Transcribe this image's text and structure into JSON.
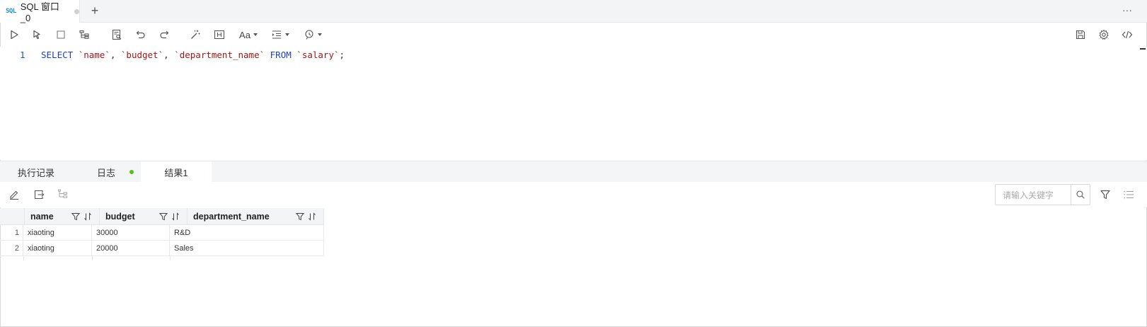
{
  "tab": {
    "icon": "sql-icon",
    "icon_text": "SQL",
    "title": "SQL 窗口_0",
    "add": "+",
    "more": "···"
  },
  "editor": {
    "line_number": "1",
    "tokens": {
      "select": "SELECT",
      "name": "`name`",
      "c1": ", ",
      "budget": "`budget`",
      "c2": ", ",
      "dept": "`department_name`",
      "from": "FROM",
      "table": "`salary`",
      "semi": ";"
    }
  },
  "result_tabs": [
    "执行记录",
    "日志",
    "结果1"
  ],
  "result_active": "结果1",
  "search": {
    "placeholder": "请输入关键字"
  },
  "table": {
    "columns": [
      "name",
      "budget",
      "department_name"
    ],
    "rows": [
      {
        "n": "1",
        "name": "xiaoting",
        "budget": "30000",
        "department_name": "R&D"
      },
      {
        "n": "2",
        "name": "xiaoting",
        "budget": "20000",
        "department_name": "Sales"
      }
    ]
  },
  "colors": {
    "keyword": "#1b3fcf",
    "identifier": "#a31515",
    "status_ok": "#52c41a",
    "tab_icon": "#1f8fd8"
  }
}
